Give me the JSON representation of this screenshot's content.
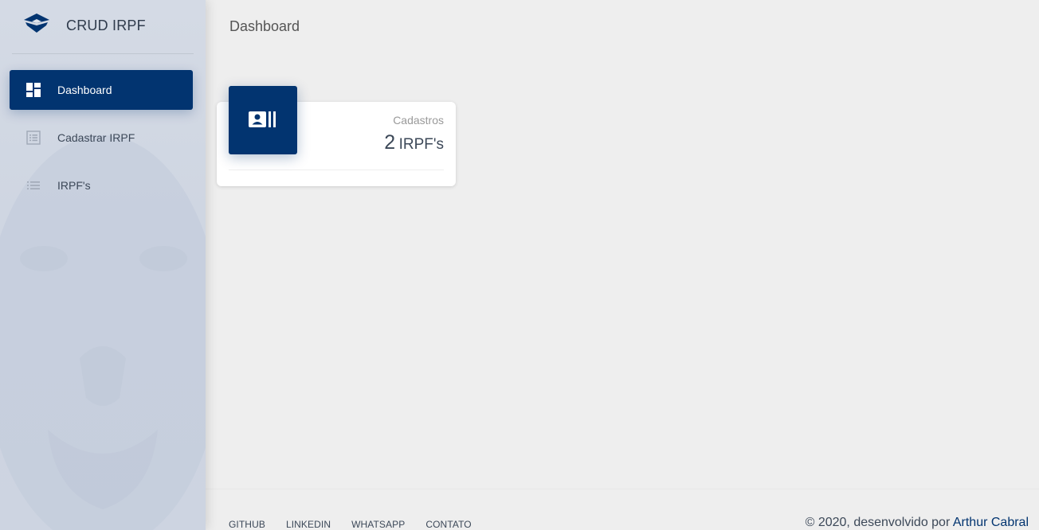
{
  "brand": {
    "title": "CRUD IRPF"
  },
  "sidebar": {
    "items": [
      {
        "label": "Dashboard",
        "icon": "dashboard-icon",
        "active": true
      },
      {
        "label": "Cadastrar IRPF",
        "icon": "list-alt-icon",
        "active": false
      },
      {
        "label": "IRPF's",
        "icon": "list-icon",
        "active": false
      }
    ]
  },
  "header": {
    "title": "Dashboard"
  },
  "stats_card": {
    "category": "Cadastros",
    "value": "2",
    "unit": "IRPF's",
    "icon": "contact-card-icon"
  },
  "footer": {
    "links": [
      "GITHUB",
      "LINKEDIN",
      "WHATSAPP",
      "CONTATO"
    ],
    "copyright_prefix": "© 2020, desenvolvido por",
    "author": "Arthur Cabral"
  },
  "colors": {
    "primary": "#023470",
    "background": "#eeeeee",
    "sidebar": "#cfd6e2"
  }
}
